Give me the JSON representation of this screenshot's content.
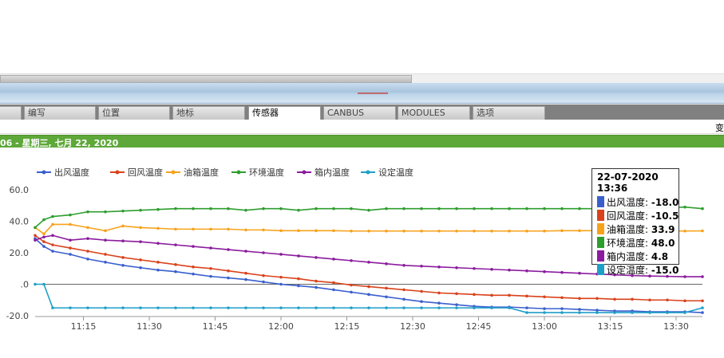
{
  "tabs": [
    {
      "label": ""
    },
    {
      "label": "编写"
    },
    {
      "label": "位置"
    },
    {
      "label": "地标"
    },
    {
      "label": "传感器",
      "active": true
    },
    {
      "label": "CANBUS"
    },
    {
      "label": "MODULES"
    },
    {
      "label": "选项"
    }
  ],
  "infobar": {
    "right_text": "变"
  },
  "header": {
    "date_text": "06 - 星期三, 七月 22, 2020"
  },
  "colors": {
    "green_bar": "#5ea83a",
    "tab_bar": "#808080"
  },
  "chart_data": {
    "type": "line",
    "title": "",
    "xlabel": "",
    "ylabel": "",
    "ylim": [
      -20,
      60
    ],
    "y_ticks": [
      60,
      40,
      20,
      0,
      -20
    ],
    "y_tick_labels": [
      "60.0",
      "40.0",
      "20.0",
      ".0",
      "-20.0"
    ],
    "xlim": [
      "11:04",
      "13:36"
    ],
    "x_ticks": [
      "11:15",
      "11:30",
      "11:45",
      "12:00",
      "12:15",
      "12:30",
      "12:45",
      "13:00",
      "13:15",
      "13:30"
    ],
    "x_times": [
      "11:04",
      "11:06",
      "11:08",
      "11:12",
      "11:16",
      "11:20",
      "11:24",
      "11:28",
      "11:32",
      "11:36",
      "11:40",
      "11:44",
      "11:48",
      "11:52",
      "11:56",
      "12:00",
      "12:04",
      "12:08",
      "12:12",
      "12:16",
      "12:20",
      "12:24",
      "12:28",
      "12:32",
      "12:36",
      "12:40",
      "12:44",
      "12:48",
      "12:52",
      "12:56",
      "13:00",
      "13:04",
      "13:08",
      "13:12",
      "13:16",
      "13:20",
      "13:24",
      "13:28",
      "13:32",
      "13:36"
    ],
    "series": [
      {
        "name": "出风温度",
        "color": "#3a5fcd",
        "values": [
          29,
          24,
          21,
          19,
          16,
          14,
          12,
          10.5,
          9,
          8,
          6.5,
          5,
          4,
          3,
          1.5,
          0,
          -1,
          -2,
          -3.5,
          -5,
          -6.5,
          -8,
          -9.5,
          -11,
          -12,
          -13,
          -14,
          -14.5,
          -14.5,
          -15,
          -15.5,
          -15.5,
          -16,
          -16.5,
          -17,
          -17,
          -17.5,
          -17.5,
          -17.5,
          -18
        ]
      },
      {
        "name": "回风温度",
        "color": "#d9421b",
        "values": [
          31,
          27,
          25,
          23,
          21,
          19,
          17,
          15.5,
          14,
          12.5,
          11,
          10,
          8.5,
          7,
          5.5,
          4.5,
          3.5,
          2,
          1,
          -0.5,
          -1.5,
          -2.5,
          -3.5,
          -4.5,
          -5.5,
          -6,
          -6.5,
          -7,
          -7,
          -7.5,
          -8,
          -8.5,
          -9,
          -9,
          -9.5,
          -9.5,
          -10,
          -10,
          -10.5,
          -10.5
        ]
      },
      {
        "name": "油箱温度",
        "color": "#f7a21b",
        "values": [
          36,
          32,
          38,
          38,
          36,
          34,
          37,
          36,
          35.5,
          35,
          35,
          35,
          35,
          34.5,
          34.5,
          34,
          34,
          34,
          34,
          33.8,
          33.8,
          33.8,
          33.8,
          33.8,
          33.8,
          33.8,
          33.8,
          33.8,
          33.8,
          33.8,
          33.8,
          34,
          34,
          34,
          34,
          33.8,
          33.8,
          33.8,
          33.8,
          33.9
        ]
      },
      {
        "name": "环境温度",
        "color": "#2e9e2e",
        "values": [
          36,
          41,
          43,
          44,
          46,
          46,
          46.5,
          47,
          47.5,
          48,
          48,
          48,
          48,
          47,
          48,
          48,
          47,
          48,
          48,
          48,
          47,
          48,
          48,
          48,
          48,
          48,
          48,
          48,
          48,
          48,
          48,
          48,
          48,
          48,
          48,
          48,
          48.5,
          48.5,
          49,
          48
        ]
      },
      {
        "name": "箱内温度",
        "color": "#8b1b9e",
        "values": [
          28,
          30,
          31,
          28,
          29,
          28,
          27.5,
          27,
          26,
          25,
          24,
          23,
          22,
          21,
          20,
          19,
          18,
          17,
          16,
          15,
          14,
          13,
          12,
          11.5,
          11,
          10.5,
          10,
          9.5,
          9,
          8.5,
          8,
          7.5,
          7,
          6.5,
          6,
          5.5,
          5.2,
          5,
          4.8,
          4.8
        ]
      },
      {
        "name": "设定温度",
        "color": "#1e9fc7",
        "values": [
          0,
          0,
          -15,
          -15,
          -15,
          -15,
          -15,
          -15,
          -15,
          -15,
          -15,
          -15,
          -15,
          -15,
          -15,
          -15,
          -15,
          -15,
          -15,
          -15,
          -15,
          -15,
          -15,
          -15,
          -15,
          -15,
          -15,
          -15,
          -15,
          -18,
          -18,
          -18,
          -18,
          -18,
          -18,
          -18,
          -18,
          -18,
          -18,
          -15
        ]
      }
    ],
    "grid": false,
    "legend_position": "top-left",
    "tooltip": {
      "title": "22-07-2020 13:36",
      "rows": [
        {
          "label": "出风温度: ",
          "value": "-18.0",
          "color": "#3a5fcd"
        },
        {
          "label": "回风温度: ",
          "value": "-10.5",
          "color": "#d9421b"
        },
        {
          "label": "油箱温度: ",
          "value": "33.9",
          "color": "#f7a21b"
        },
        {
          "label": "环境温度: ",
          "value": "48.0",
          "color": "#2e9e2e"
        },
        {
          "label": "箱内温度: ",
          "value": "4.8",
          "color": "#8b1b9e"
        },
        {
          "label": "设定温度: ",
          "value": "-15.0",
          "color": "#1e9fc7"
        }
      ]
    }
  }
}
